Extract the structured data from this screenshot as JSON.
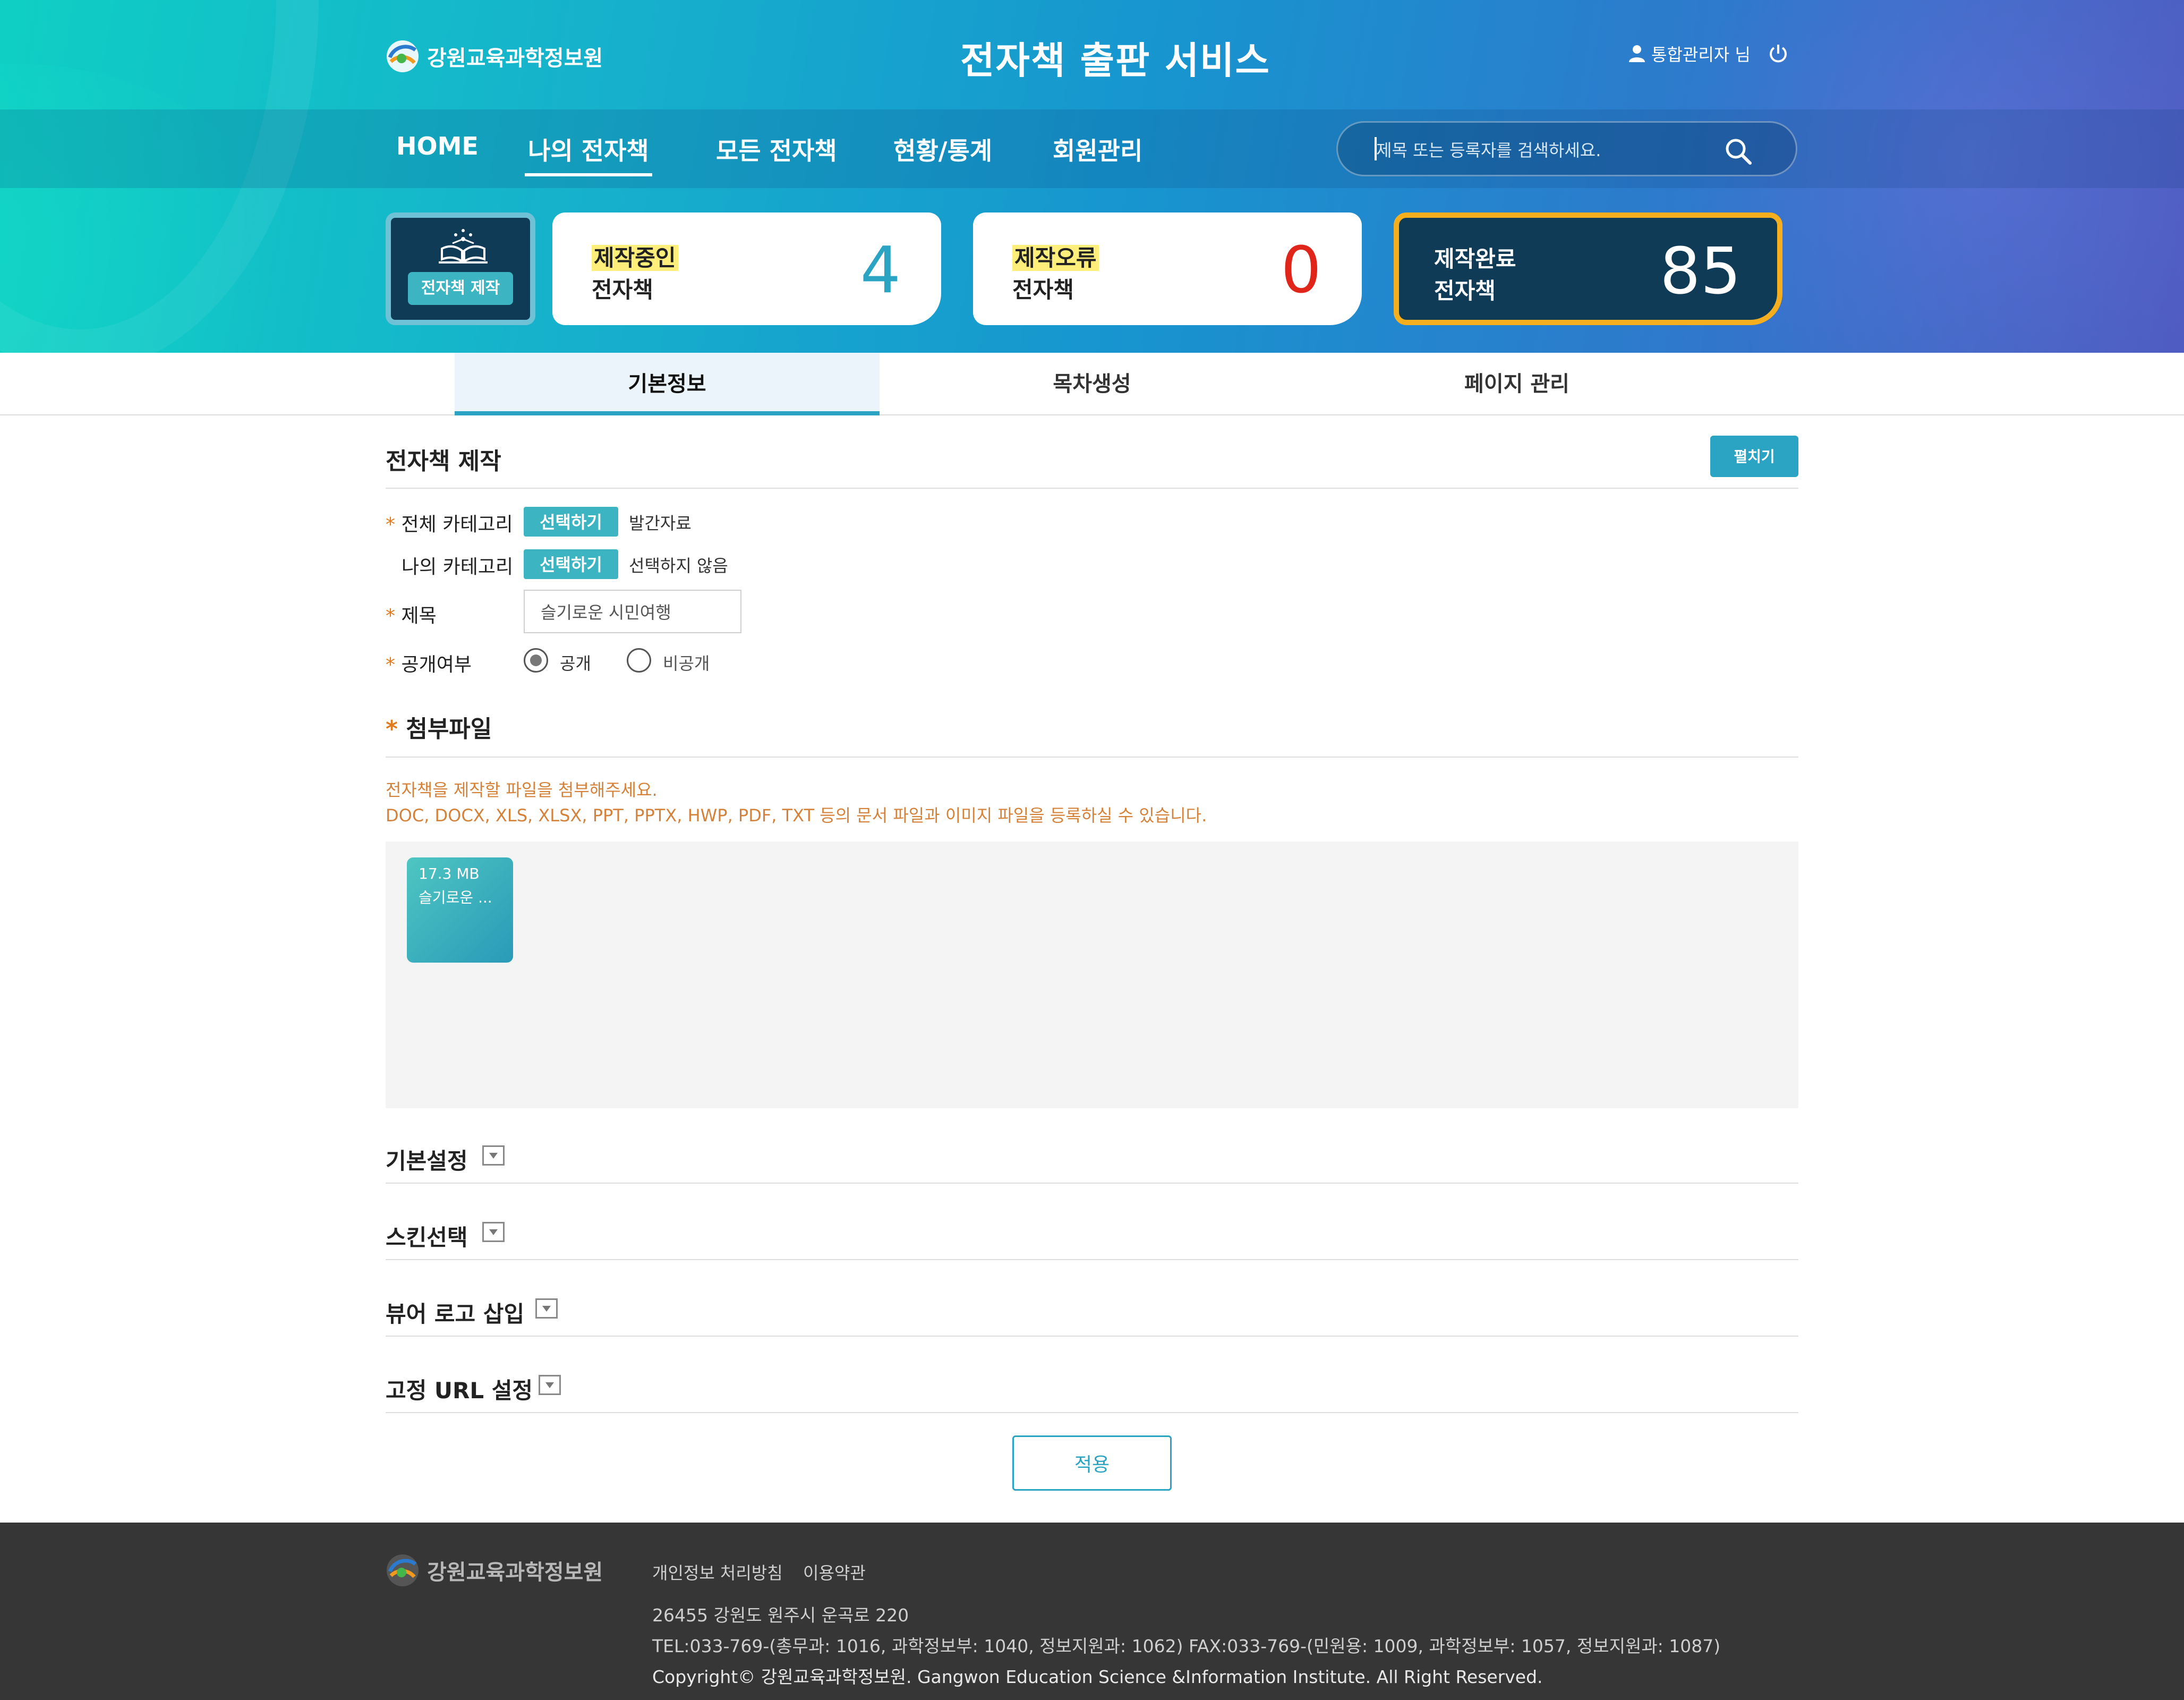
{
  "header": {
    "org_name": "강원교육과학정보원",
    "site_title": "전자책 출판 서비스",
    "user_label": "통합관리자 님"
  },
  "nav": {
    "items": [
      {
        "label": "HOME"
      },
      {
        "label": "나의 전자책"
      },
      {
        "label": "모든 전자책"
      },
      {
        "label": "현황/통계"
      },
      {
        "label": "회원관리"
      }
    ],
    "active": "나의 전자책",
    "search_placeholder": "제목 또는 등록자를 검색하세요."
  },
  "stats": {
    "make_button": "전자책 제작",
    "cards": [
      {
        "label1": "제작중인",
        "label2": "전자책",
        "value": "4",
        "color": "#2ba4c4"
      },
      {
        "label1": "제작오류",
        "label2": "전자책",
        "value": "0",
        "color": "#e0261a"
      },
      {
        "label1": "제작완료",
        "label2": "전자책",
        "value": "85",
        "color": "#ffffff"
      }
    ]
  },
  "tabs": [
    {
      "label": "기본정보"
    },
    {
      "label": "목차생성"
    },
    {
      "label": "페이지 관리"
    }
  ],
  "form": {
    "section_title": "전자책 제작",
    "expand_button": "펼치기",
    "required_mark": "*",
    "category_all": {
      "label": "전체 카테고리",
      "button": "선택하기",
      "value": "발간자료"
    },
    "category_mine": {
      "label": "나의 카테고리",
      "button": "선택하기",
      "value": "선택하지 않음"
    },
    "title": {
      "label": "제목",
      "value": "슬기로운 시민여행"
    },
    "visibility": {
      "label": "공개여부",
      "options": [
        "공개",
        "비공개"
      ],
      "selected": "공개"
    }
  },
  "attachment": {
    "title": "첨부파일",
    "note1": "전자책을 제작할 파일을 첨부해주세요.",
    "note2": "DOC, DOCX, XLS, XLSX, PPT, PPTX, HWP, PDF, TXT 등의 문서 파일과 이미지 파일을 등록하실 수 있습니다.",
    "file": {
      "size": "17.3 MB",
      "name": "슬기로운 ..."
    }
  },
  "folds": [
    {
      "label": "기본설정"
    },
    {
      "label": "스킨선택"
    },
    {
      "label": "뷰어 로고 삽입"
    },
    {
      "label": "고정 URL 설정"
    }
  ],
  "apply_button": "적용",
  "footer": {
    "org_name": "강원교육과학정보원",
    "links": [
      "개인정보 처리방침",
      "이용약관"
    ],
    "address": "26455 강원도 원주시 운곡로 220",
    "tel": "TEL:033-769-(총무과: 1016, 과학정보부: 1040, 정보지원과: 1062) FAX:033-769-(민원용: 1009, 과학정보부: 1057, 정보지원과: 1087)",
    "copyright": "Copyright© 강원교육과학정보원. Gangwon Education Science &Information Institute. All Right Reserved."
  },
  "colors": {
    "accent": "#2ba4c4",
    "dark_card": "#0f3b57",
    "highlight_border": "#f4ae1e",
    "error": "#e0261a",
    "note": "#d4823a"
  }
}
